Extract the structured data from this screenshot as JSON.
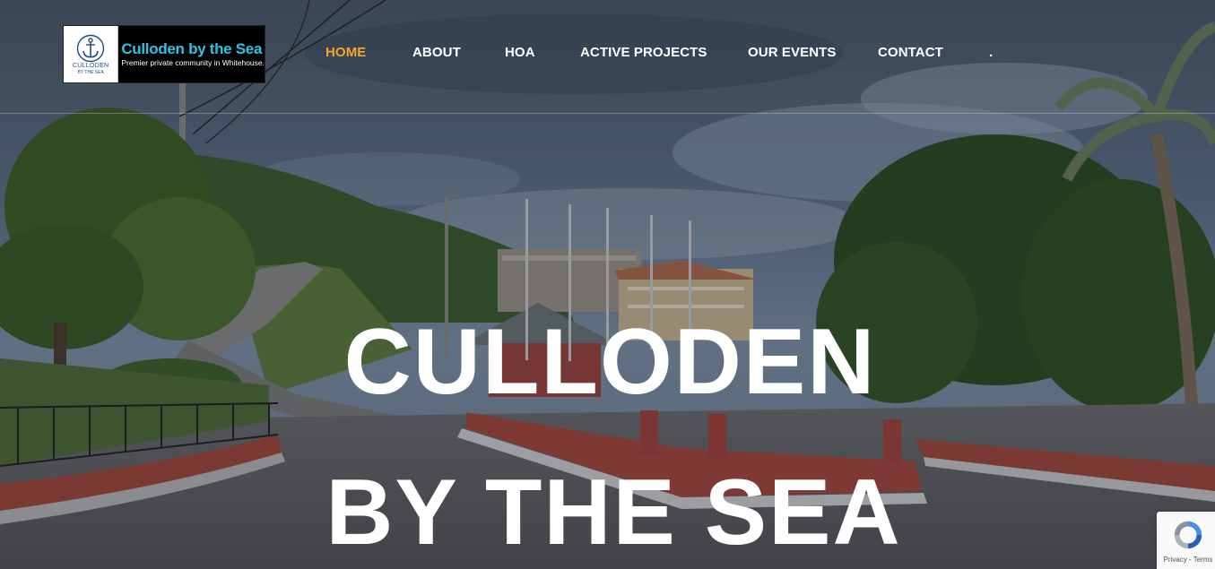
{
  "logo": {
    "mark_text": "CULLODEN",
    "mark_subtext": "BY THE SEA",
    "name": "Culloden by the Sea",
    "tagline": "Premier private community in Whitehouse."
  },
  "nav": {
    "items": [
      {
        "label": "HOME",
        "active": true
      },
      {
        "label": "ABOUT",
        "active": false
      },
      {
        "label": "HOA",
        "active": false
      },
      {
        "label": "ACTIVE PROJECTS",
        "active": false
      },
      {
        "label": "OUR EVENTS",
        "active": false
      },
      {
        "label": "CONTACT",
        "active": false
      },
      {
        "label": ".",
        "active": false
      }
    ]
  },
  "hero": {
    "title_line1": "CULLODEN",
    "title_line2": "BY THE SEA"
  },
  "recaptcha": {
    "privacy": "Privacy",
    "separator": " - ",
    "terms": "Terms"
  },
  "colors": {
    "nav_active": "#f5a623",
    "nav_default": "#ffffff",
    "logo_name": "#2ec4e6",
    "headline": "#ffffff"
  }
}
